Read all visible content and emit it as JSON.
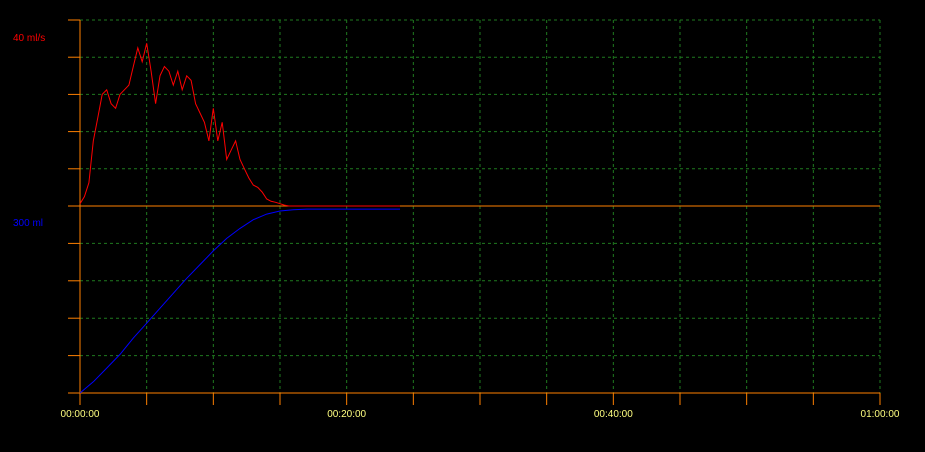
{
  "chart_data": {
    "type": "line",
    "colors": {
      "background": "#000000",
      "axis": "#ff8000",
      "grid": "#1f7a1f",
      "flow": "#ff0000",
      "volume": "#0000ff",
      "tick_text": "#ffff80"
    },
    "grid": true,
    "x_axis": {
      "range_seconds": [
        0,
        3600
      ],
      "major_tick_seconds": 300,
      "tick_labels": [
        {
          "seconds": 0,
          "label": "00:00:00"
        },
        {
          "seconds": 1200,
          "label": "00:20:00"
        },
        {
          "seconds": 2400,
          "label": "00:40:00"
        },
        {
          "seconds": 3600,
          "label": "01:00:00"
        }
      ]
    },
    "panels": [
      {
        "name": "flow",
        "max_label": "40 ml/s",
        "ylim": [
          0,
          40
        ],
        "grid_lines": 5,
        "series": {
          "x_seconds": [
            0,
            20,
            40,
            60,
            80,
            100,
            120,
            140,
            160,
            180,
            200,
            220,
            240,
            260,
            280,
            300,
            320,
            340,
            360,
            380,
            400,
            420,
            440,
            460,
            480,
            500,
            520,
            540,
            560,
            580,
            600,
            620,
            640,
            660,
            680,
            700,
            720,
            740,
            760,
            780,
            800,
            820,
            840,
            860,
            880,
            900,
            920,
            940,
            960,
            980,
            1000,
            1020,
            1040,
            1060,
            1080,
            1100,
            1120,
            1140,
            1160,
            1180,
            1200,
            1440
          ],
          "values": [
            0.5,
            2,
            5,
            14,
            19,
            24,
            25,
            22,
            21,
            24,
            25,
            26,
            30,
            34,
            31,
            35,
            29,
            22,
            28,
            30,
            29,
            26,
            29,
            25,
            28,
            27,
            22,
            20,
            18,
            14,
            21,
            14,
            18,
            10,
            12,
            14,
            10,
            8,
            6,
            4.5,
            4,
            3,
            1.5,
            1,
            0.8,
            0.5,
            0.2,
            0,
            0,
            0,
            0,
            0,
            0,
            0,
            0,
            0,
            0,
            0,
            0,
            0,
            0,
            0
          ]
        }
      },
      {
        "name": "volume",
        "max_label": "300 ml",
        "ylim": [
          0,
          300
        ],
        "grid_lines": 5,
        "series": {
          "x_seconds": [
            0,
            60,
            120,
            180,
            240,
            300,
            360,
            420,
            480,
            540,
            600,
            660,
            720,
            780,
            840,
            900,
            960,
            1020,
            1080,
            1200,
            1320,
            1440
          ],
          "values": [
            0,
            18,
            40,
            62,
            88,
            112,
            136,
            160,
            184,
            206,
            228,
            248,
            264,
            278,
            287,
            292,
            294,
            295,
            295,
            295,
            295,
            295
          ]
        }
      }
    ]
  }
}
